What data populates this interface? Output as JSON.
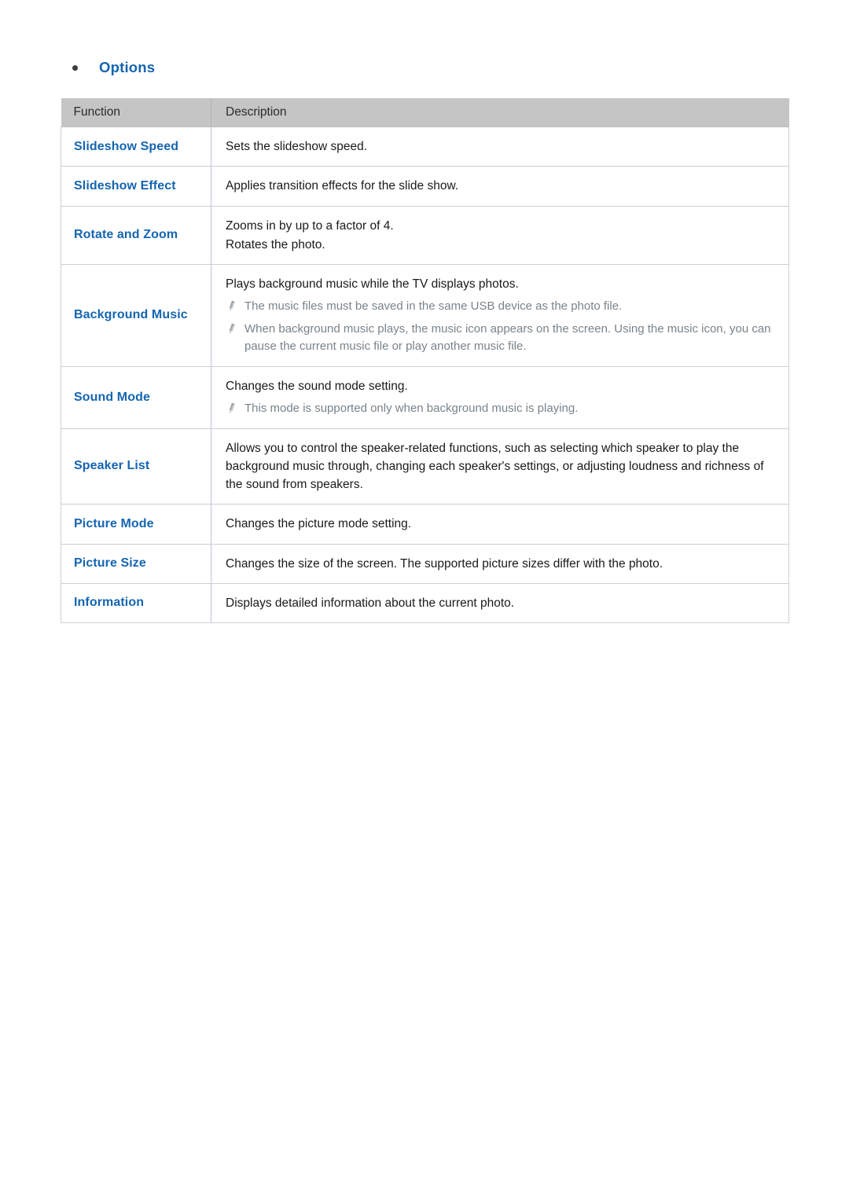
{
  "heading": {
    "bullet_icon": "bullet-dot-icon",
    "title": "Options"
  },
  "table": {
    "columns": [
      {
        "key": "function",
        "label": "Function"
      },
      {
        "key": "description",
        "label": "Description"
      }
    ],
    "rows": [
      {
        "function": "Slideshow Speed",
        "lines": [
          "Sets the slideshow speed."
        ],
        "notes": []
      },
      {
        "function": "Slideshow Effect",
        "lines": [
          "Applies transition effects for the slide show."
        ],
        "notes": []
      },
      {
        "function": "Rotate and Zoom",
        "lines": [
          "Zooms in by up to a factor of 4.",
          "Rotates the photo."
        ],
        "notes": []
      },
      {
        "function": "Background Music",
        "lines": [
          "Plays background music while the TV displays photos."
        ],
        "notes": [
          "The music files must be saved in the same USB device as the photo file.",
          "When background music plays, the music icon appears on the screen. Using the music icon, you can pause the current music file or play another music file."
        ]
      },
      {
        "function": "Sound Mode",
        "lines": [
          "Changes the sound mode setting."
        ],
        "notes": [
          "This mode is supported only when background music is playing."
        ]
      },
      {
        "function": "Speaker List",
        "lines": [
          "Allows you to control the speaker-related functions, such as selecting which speaker to play the background music through, changing each speaker's settings, or adjusting loudness and richness of the sound from speakers."
        ],
        "notes": []
      },
      {
        "function": "Picture Mode",
        "lines": [
          "Changes the picture mode setting."
        ],
        "notes": []
      },
      {
        "function": "Picture Size",
        "lines": [
          "Changes the size of the screen. The supported picture sizes differ with the photo."
        ],
        "notes": []
      },
      {
        "function": "Information",
        "lines": [
          "Displays detailed information about the current photo."
        ],
        "notes": []
      }
    ]
  },
  "colors": {
    "link_blue": "#1565b0",
    "header_bg": "#c5c5c5",
    "note_gray": "#79838a",
    "body_text": "#1a1a1a",
    "row_border": "#cfcfcf",
    "column_divider": "#bcc3d6"
  },
  "icons": {
    "note": "pencil-icon"
  }
}
